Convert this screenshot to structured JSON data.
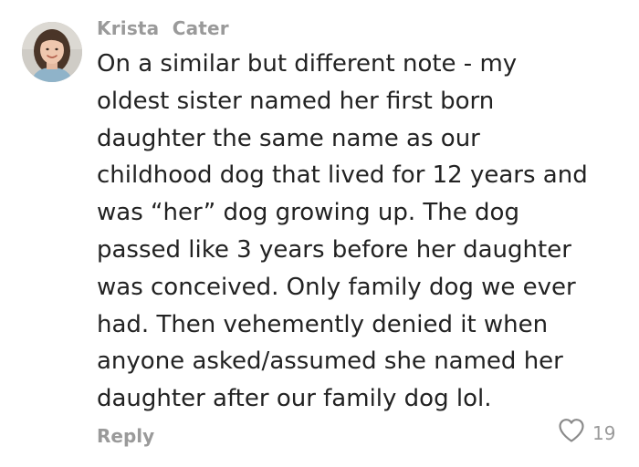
{
  "comment": {
    "author": "Krista  Cater",
    "body_lines": [
      "On a similar but different note - my",
      "oldest sister named her first born",
      "daughter the same name as our",
      "childhood dog that lived for 12 years and",
      "was “her” dog growing up. The dog",
      "passed like 3 years before her daughter",
      "was conceived. Only family dog we ever",
      "had. Then vehemently denied it when",
      "anyone asked/assumed she named her",
      "daughter after our family dog lol."
    ],
    "reply_label": "Reply",
    "like_count": "19"
  },
  "colors": {
    "meta_text": "#9a9a9a",
    "body_text": "#222222",
    "heart_stroke": "#8a8a8a"
  },
  "icons": {
    "avatar": "user-avatar-photo",
    "like": "heart-outline-icon"
  }
}
